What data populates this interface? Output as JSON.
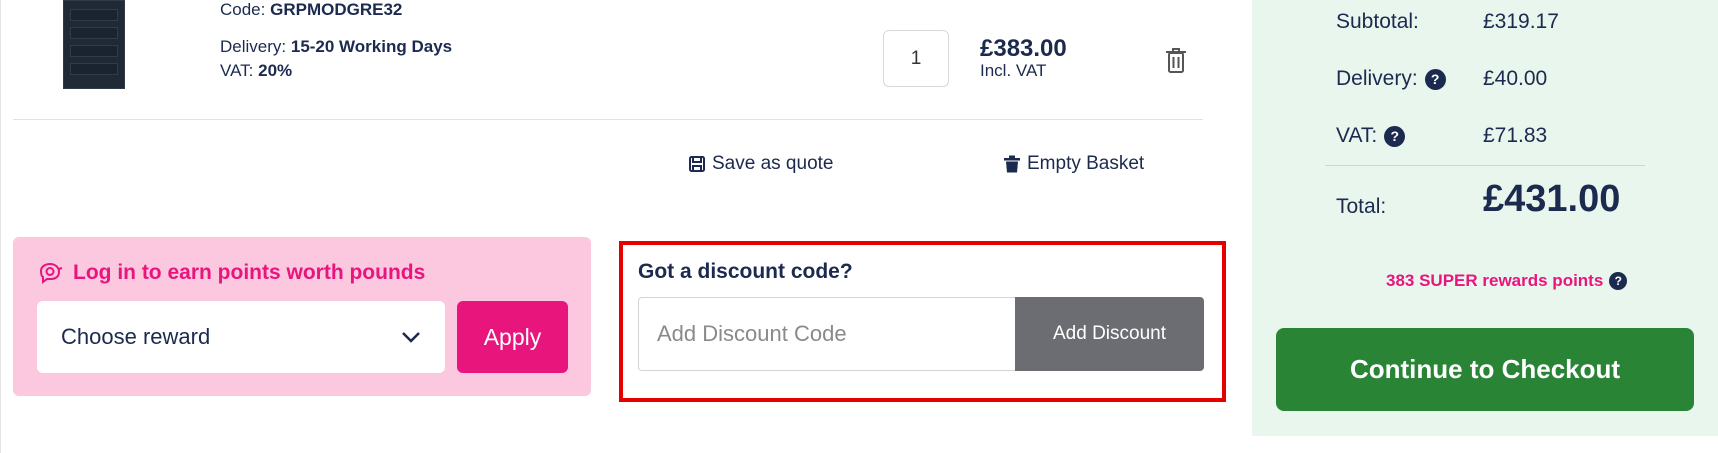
{
  "product": {
    "code_label": "Code:",
    "code_value": "GRPMODGRE32",
    "delivery_label": "Delivery:",
    "delivery_value": "15-20 Working Days",
    "vat_label": "VAT:",
    "vat_value": "20%",
    "quantity": "1",
    "price": "£383.00",
    "price_note": "Incl. VAT"
  },
  "actions": {
    "save_quote": "Save as quote",
    "empty_basket": "Empty Basket"
  },
  "rewards": {
    "title": "Log in to earn points worth pounds",
    "select_value": "Choose reward",
    "apply_label": "Apply"
  },
  "discount": {
    "title": "Got a discount code?",
    "placeholder": "Add Discount Code",
    "button_label": "Add Discount"
  },
  "summary": {
    "subtotal_label": "Subtotal:",
    "subtotal_value": "£319.17",
    "delivery_label": "Delivery:",
    "delivery_value": "£40.00",
    "vat_label": "VAT:",
    "vat_value": "£71.83",
    "total_label": "Total:",
    "total_value": "£431.00",
    "points_text": "383 SUPER rewards points",
    "checkout_label": "Continue to Checkout"
  },
  "icons": {
    "help": "?",
    "trash": "trash-icon",
    "save": "floppy-disk-icon",
    "chevron": "chevron-down-icon",
    "rewards": "piggy-coin-icon"
  },
  "colors": {
    "navy": "#1b2a4e",
    "pink": "#e8157d",
    "pink_bg": "#fbc8e0",
    "green": "#2a8436",
    "summary_bg": "#e9f6ee",
    "discount_button": "#6c6d72",
    "highlight": "#e50000"
  }
}
